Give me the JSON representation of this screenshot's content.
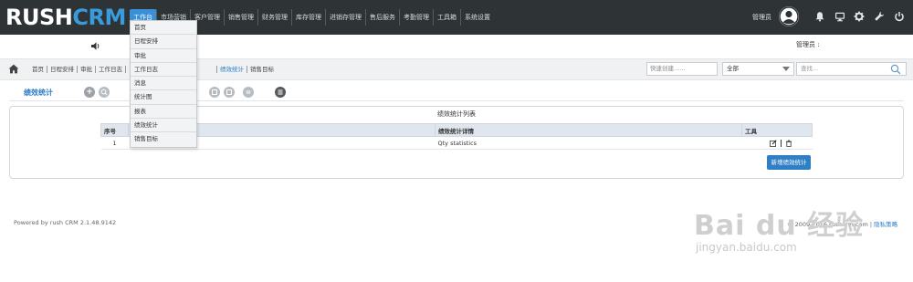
{
  "app": {
    "logo_rush": "RUSH",
    "logo_crm": "CRM"
  },
  "nav": {
    "items": [
      {
        "label": "工作台",
        "active": true
      },
      {
        "label": "市场营销"
      },
      {
        "label": "客户管理"
      },
      {
        "label": "销售管理"
      },
      {
        "label": "财务管理"
      },
      {
        "label": "库存管理"
      },
      {
        "label": "进销存管理"
      },
      {
        "label": "售后服务"
      },
      {
        "label": "考勤管理"
      },
      {
        "label": "工具箱"
      },
      {
        "label": "系统设置"
      }
    ]
  },
  "header": {
    "user_label": "管理员",
    "icons": [
      "bell-icon",
      "monitor-icon",
      "gear-icon",
      "wrench-icon",
      "power-icon"
    ]
  },
  "subbar": {
    "admin_label": "管理员 :"
  },
  "dropdown": {
    "items": [
      "首页",
      "日程安排",
      "审批",
      "工作日志",
      "消息",
      "统计图",
      "报表",
      "绩效统计",
      "销售目标"
    ]
  },
  "breadcrumb": {
    "items": [
      "首页",
      "日程安排",
      "审批",
      "工作日志",
      "",
      "绩效统计",
      "销售目标"
    ],
    "active_index": 5
  },
  "toolbar": {
    "quick_create_placeholder": "快速创建......",
    "scope_value": "全部",
    "search_placeholder": "查找..."
  },
  "page": {
    "title": "绩效统计"
  },
  "list": {
    "title": "绩效统计列表",
    "columns": [
      "序号",
      "",
      "绩效统计详情",
      "工具"
    ],
    "rows": [
      {
        "index": "1",
        "name": "Qty statistics",
        "detail": "Qty statistics"
      }
    ],
    "add_button": "新增绩效统计"
  },
  "footer": {
    "powered_by": "Powered by rush CRM 2.1.48.9142",
    "copyright": "© 2009-2016 rushcrm.com",
    "privacy": "隐私策略"
  },
  "watermark": {
    "brand": "Bai du 经验",
    "url": "jingyan.baidu.com"
  },
  "colors": {
    "topbar": "#2e3336",
    "accent": "#3a8fd6",
    "logo_crm": "#3a9bdc"
  }
}
